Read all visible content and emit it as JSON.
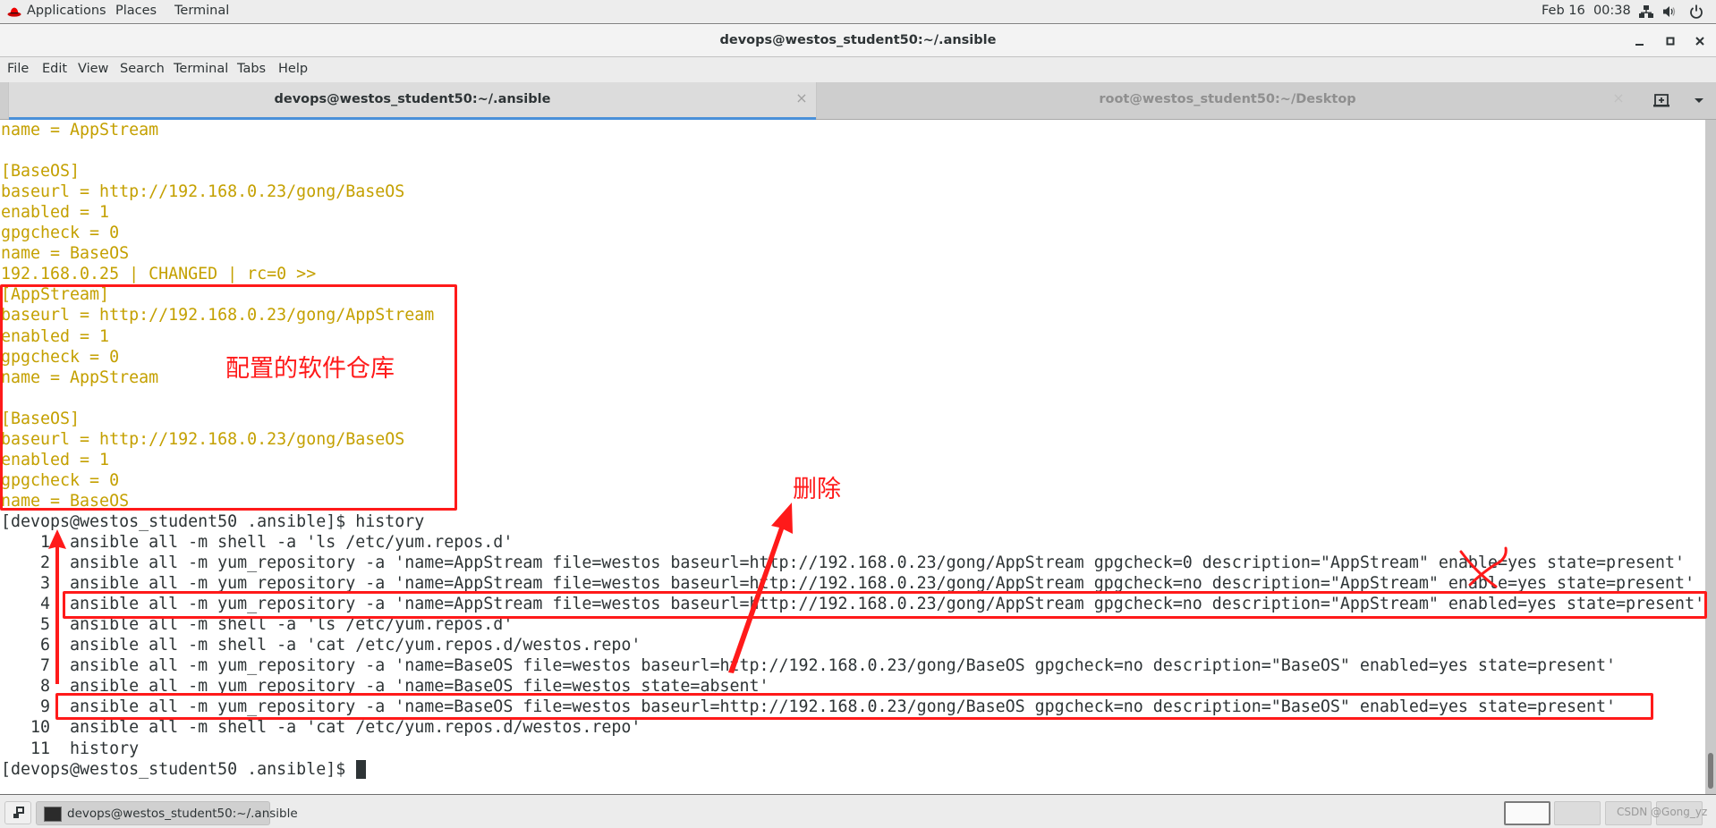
{
  "top_panel": {
    "applications_label": "Applications",
    "places_label": "Places",
    "terminal_label": "Terminal",
    "datetime": "Feb 16  00:38"
  },
  "window": {
    "title": "devops@westos_student50:~/.ansible"
  },
  "menubar": {
    "items": [
      "File",
      "Edit",
      "View",
      "Search",
      "Terminal",
      "Tabs",
      "Help"
    ]
  },
  "tabs": [
    {
      "title": "devops@westos_student50:~/.ansible",
      "active": true
    },
    {
      "title": "root@westos_student50:~/Desktop",
      "active": false
    }
  ],
  "colors": {
    "output_text": "#c4a000",
    "command_text": "#2e3436",
    "annotation": "#ff1a1a",
    "active_tab_indicator": "#4a90d9"
  },
  "terminal": {
    "lines": [
      {
        "text": "name = AppStream",
        "style": "yellow"
      },
      {
        "text": "",
        "style": "yellow"
      },
      {
        "text": "[BaseOS]",
        "style": "yellow"
      },
      {
        "text": "baseurl = http://192.168.0.23/gong/BaseOS",
        "style": "yellow"
      },
      {
        "text": "enabled = 1",
        "style": "yellow"
      },
      {
        "text": "gpgcheck = 0",
        "style": "yellow"
      },
      {
        "text": "name = BaseOS",
        "style": "yellow"
      },
      {
        "text": "192.168.0.25 | CHANGED | rc=0 >>",
        "style": "yellow"
      },
      {
        "text": "[AppStream]",
        "style": "yellow"
      },
      {
        "text": "baseurl = http://192.168.0.23/gong/AppStream",
        "style": "yellow"
      },
      {
        "text": "enabled = 1",
        "style": "yellow"
      },
      {
        "text": "gpgcheck = 0",
        "style": "yellow"
      },
      {
        "text": "name = AppStream",
        "style": "yellow"
      },
      {
        "text": "",
        "style": "yellow"
      },
      {
        "text": "[BaseOS]",
        "style": "yellow"
      },
      {
        "text": "baseurl = http://192.168.0.23/gong/BaseOS",
        "style": "yellow"
      },
      {
        "text": "enabled = 1",
        "style": "yellow"
      },
      {
        "text": "gpgcheck = 0",
        "style": "yellow"
      },
      {
        "text": "name = BaseOS",
        "style": "yellow"
      },
      {
        "text": "[devops@westos_student50 .ansible]$ history",
        "style": "dark"
      },
      {
        "text": "    1  ansible all -m shell -a 'ls /etc/yum.repos.d'",
        "style": "dark"
      },
      {
        "text": "    2  ansible all -m yum_repository -a 'name=AppStream file=westos baseurl=http://192.168.0.23/gong/AppStream gpgcheck=0 description=\"AppStream\" enable=yes state=present'",
        "style": "dark"
      },
      {
        "text": "    3  ansible all -m yum_repository -a 'name=AppStream file=westos baseurl=http://192.168.0.23/gong/AppStream gpgcheck=no description=\"AppStream\" enable=yes state=present'",
        "style": "dark"
      },
      {
        "text": "    4  ansible all -m yum_repository -a 'name=AppStream file=westos baseurl=http://192.168.0.23/gong/AppStream gpgcheck=no description=\"AppStream\" enabled=yes state=present'",
        "style": "dark"
      },
      {
        "text": "    5  ansible all -m shell -a 'ls /etc/yum.repos.d'",
        "style": "dark"
      },
      {
        "text": "    6  ansible all -m shell -a 'cat /etc/yum.repos.d/westos.repo'",
        "style": "dark"
      },
      {
        "text": "    7  ansible all -m yum_repository -a 'name=BaseOS file=westos baseurl=http://192.168.0.23/gong/BaseOS gpgcheck=no description=\"BaseOS\" enabled=yes state=present'",
        "style": "dark"
      },
      {
        "text": "    8  ansible all -m yum_repository -a 'name=BaseOS file=westos state=absent'",
        "style": "dark"
      },
      {
        "text": "    9  ansible all -m yum_repository -a 'name=BaseOS file=westos baseurl=http://192.168.0.23/gong/BaseOS gpgcheck=no description=\"BaseOS\" enabled=yes state=present'",
        "style": "dark"
      },
      {
        "text": "   10  ansible all -m shell -a 'cat /etc/yum.repos.d/westos.repo'",
        "style": "dark"
      },
      {
        "text": "   11  history",
        "style": "dark"
      },
      {
        "text": "[devops@westos_student50 .ansible]$ ",
        "style": "dark"
      }
    ]
  },
  "annotations": {
    "repo_config_label": "配置的软件仓库",
    "delete_label": "删除"
  },
  "taskbar": {
    "task_label": "devops@westos_student50:~/.ansible",
    "watermark": "CSDN @Gong_yz"
  }
}
